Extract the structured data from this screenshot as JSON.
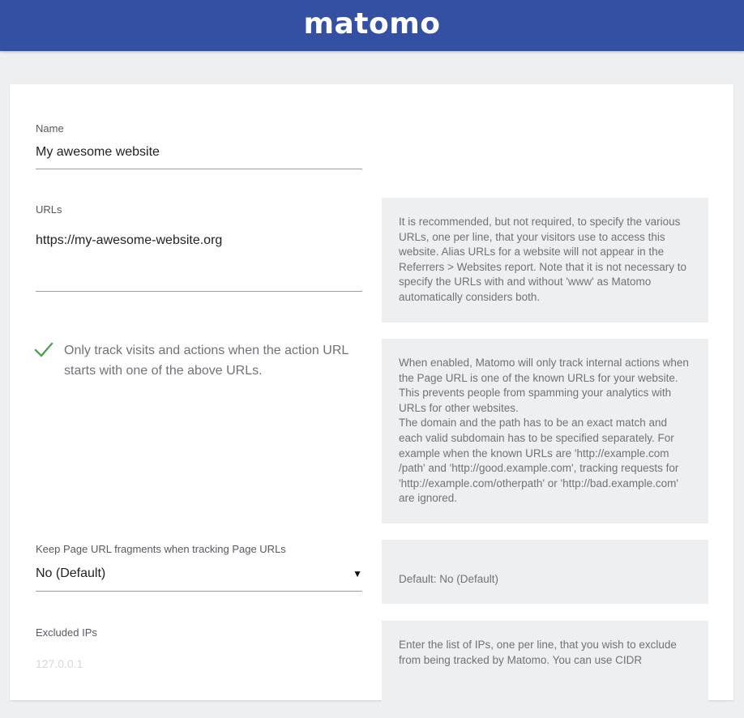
{
  "header": {
    "logo_text": "matomo",
    "bar_color": "#3450a3"
  },
  "form": {
    "name": {
      "label": "Name",
      "value": "My awesome website"
    },
    "urls": {
      "label": "URLs",
      "value": "https://my-awesome-website.org",
      "help": "It is recommended, but not required, to specify the various URLs, one per line, that your visitors use to access this website. Alias URLs for a website will not appear in the Referrers > Websites report. Note that it is not necessary to specify the URLs with and without 'www' as Matomo automatically considers both."
    },
    "only_track": {
      "label": "Only track visits and actions when the action URL starts with one of the above URLs.",
      "checked": true,
      "help_1": "When enabled, Matomo will only track internal actions when the Page URL is one of the known URLs for your website. This prevents people from spamming your analytics with URLs for other websites.",
      "help_2": "The domain and the path has to be an exact match and each valid subdomain has to be specified separately. For example when the known URLs are 'http://example.com /path' and 'http://good.example.com', tracking requests for 'http://example.com/otherpath' or 'http://bad.example.com' are ignored."
    },
    "keep_fragments": {
      "label": "Keep Page URL fragments when tracking Page URLs",
      "selected": "No (Default)",
      "help": "Default: No (Default)"
    },
    "excluded_ips": {
      "label": "Excluded IPs",
      "placeholder": "127.0.0.1",
      "help": "Enter the list of IPs, one per line, that you wish to exclude from being tracked by Matomo. You can use CIDR"
    }
  },
  "colors": {
    "check_green": "#43a047"
  }
}
